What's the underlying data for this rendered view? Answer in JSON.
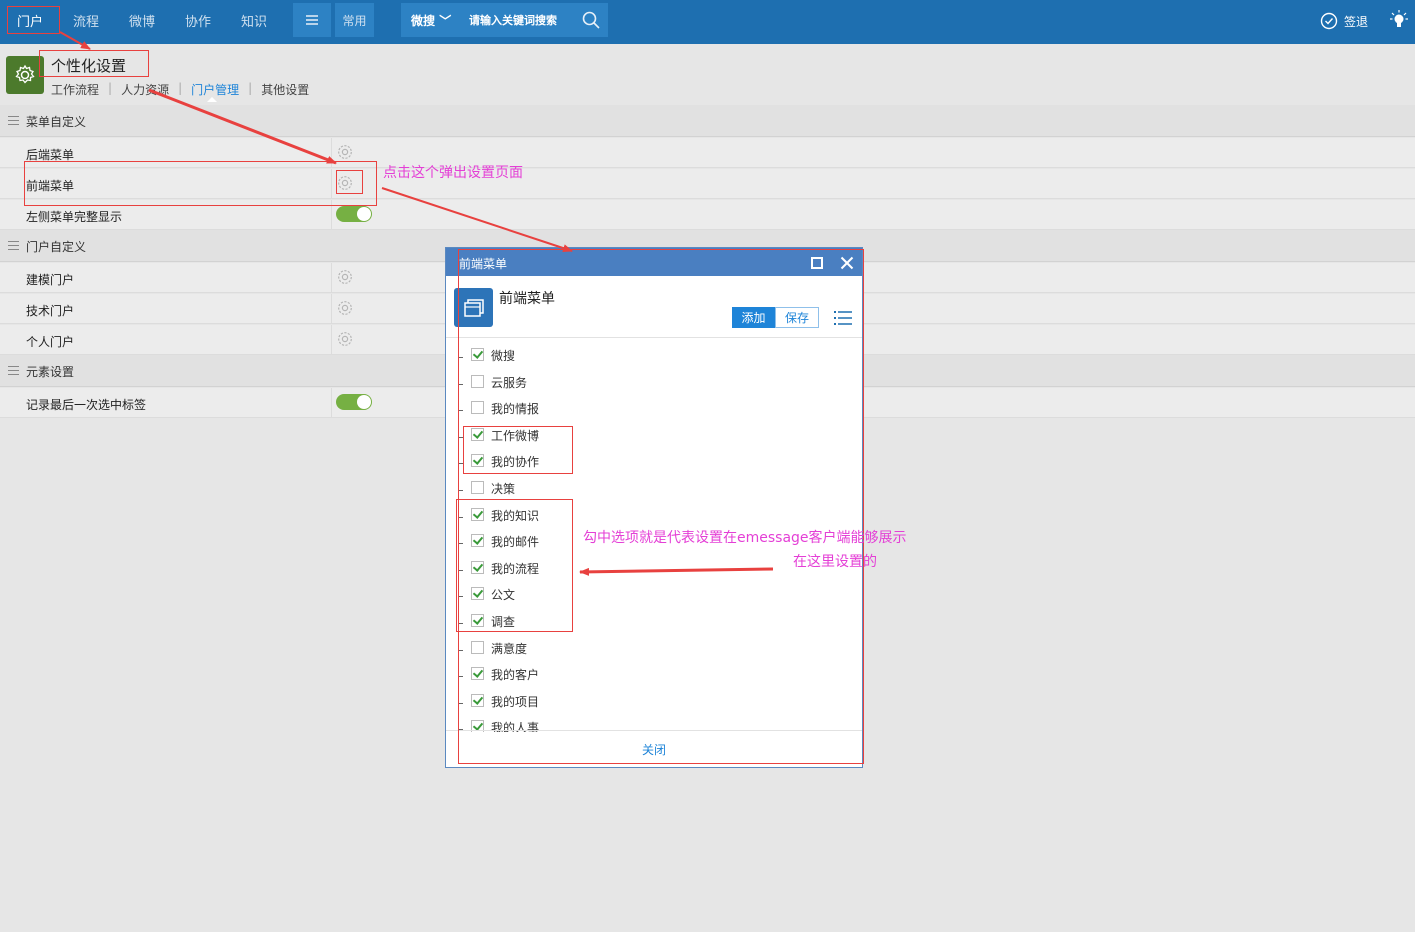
{
  "topbar": {
    "nav": [
      "门户",
      "流程",
      "微博",
      "协作",
      "知识"
    ],
    "menu_icon": "menu-icon",
    "common_label": "常用",
    "search_scope": "微搜",
    "search_placeholder": "请输入关键词搜索",
    "logout_label": "签退",
    "accent": "#1e6fb0"
  },
  "page": {
    "title": "个性化设置",
    "subtabs": [
      "工作流程",
      "人力资源",
      "门户管理",
      "其他设置"
    ],
    "active_subtab": "门户管理"
  },
  "sections": {
    "menu": {
      "title": "菜单自定义",
      "rows": {
        "backend": "后端菜单",
        "frontend": "前端菜单",
        "left_full": "左侧菜单完整显示"
      }
    },
    "portal": {
      "title": "门户自定义",
      "rows": {
        "modeling": "建模门户",
        "tech": "技术门户",
        "personal": "个人门户"
      }
    },
    "element": {
      "title": "元素设置",
      "rows": {
        "remember_tab": "记录最后一次选中标签"
      }
    }
  },
  "dialog": {
    "title": "前端菜单",
    "heading": "前端菜单",
    "add_label": "添加",
    "save_label": "保存",
    "close_label": "关闭",
    "items": [
      {
        "label": "微搜",
        "checked": true
      },
      {
        "label": "云服务",
        "checked": false
      },
      {
        "label": "我的情报",
        "checked": false
      },
      {
        "label": "工作微博",
        "checked": true
      },
      {
        "label": "我的协作",
        "checked": true
      },
      {
        "label": "决策",
        "checked": false
      },
      {
        "label": "我的知识",
        "checked": true
      },
      {
        "label": "我的邮件",
        "checked": true
      },
      {
        "label": "我的流程",
        "checked": true
      },
      {
        "label": "公文",
        "checked": true
      },
      {
        "label": "调查",
        "checked": true
      },
      {
        "label": "满意度",
        "checked": false
      },
      {
        "label": "我的客户",
        "checked": true
      },
      {
        "label": "我的项目",
        "checked": true
      },
      {
        "label": "我的人事",
        "checked": true
      }
    ]
  },
  "annotations": {
    "click_hint": "点击这个弹出设置页面",
    "check_hint_1": "勾中选项就是代表设置在emessage客户端能够展示",
    "check_hint_2": "在这里设置的",
    "color": "#e43fd6"
  }
}
